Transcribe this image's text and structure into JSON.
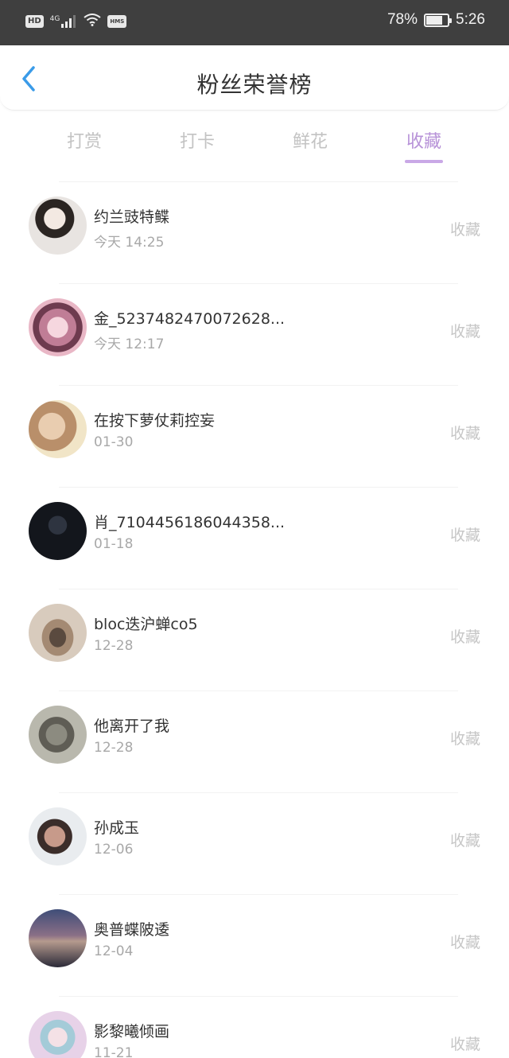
{
  "status_bar": {
    "left_badges": [
      "HD",
      "4G",
      "HMS"
    ],
    "battery_level": 0.78,
    "battery_text": "78%",
    "time": "5:26"
  },
  "header": {
    "title": "粉丝荣誉榜",
    "back_icon": "chevron-left-icon",
    "accent_color": "#3a9be8"
  },
  "tabs": {
    "items": [
      {
        "label": "打赏"
      },
      {
        "label": "打卡"
      },
      {
        "label": "鲜花"
      },
      {
        "label": "收藏"
      }
    ],
    "active_color": "#b792d8"
  },
  "list": {
    "action_label": "收藏",
    "rows": [
      {
        "name": "约兰豉特鲽",
        "date": "今天 14:25",
        "avatar": "avatar-anime-boy"
      },
      {
        "name": "金_5237482470072628...",
        "date": "今天 12:17",
        "avatar": "avatar-pink-anime"
      },
      {
        "name": "在按下萝仗莉控妄",
        "date": "01-30",
        "avatar": "avatar-blonde-girl"
      },
      {
        "name": "肖_7104456186044358...",
        "date": "01-18",
        "avatar": "avatar-dark-water"
      },
      {
        "name": "bloc迭沪蝉co5",
        "date": "12-28",
        "avatar": "avatar-sleeping-dog"
      },
      {
        "name": "他离开了我",
        "date": "12-28",
        "avatar": "avatar-cat"
      },
      {
        "name": "孙成玉",
        "date": "12-06",
        "avatar": "avatar-selfie"
      },
      {
        "name": "奥普蝶陂逶",
        "date": "12-04",
        "avatar": "avatar-city-night"
      },
      {
        "name": "影黎曦倾画",
        "date": "11-21",
        "avatar": "avatar-anime-girl"
      }
    ]
  }
}
